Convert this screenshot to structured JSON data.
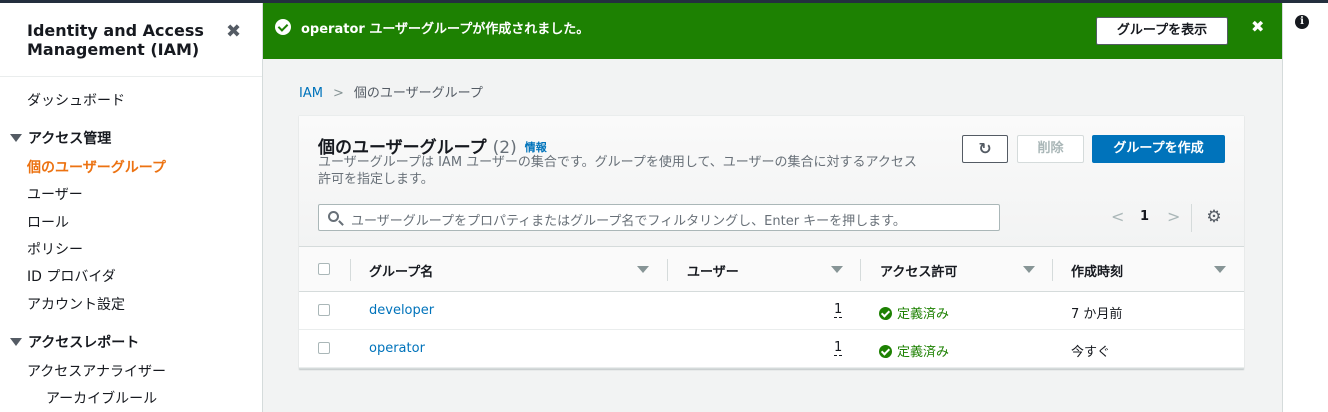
{
  "sidebar": {
    "title": "Identity and Access Management (IAM)",
    "dashboard": "ダッシュボード",
    "access_management": {
      "label": "アクセス管理",
      "items": [
        "個のユーザーグループ",
        "ユーザー",
        "ロール",
        "ポリシー",
        "ID プロバイダ",
        "アカウント設定"
      ]
    },
    "access_reports": {
      "label": "アクセスレポート",
      "items": [
        "アクセスアナライザー",
        "アーカイブルール"
      ]
    }
  },
  "flash": {
    "message": "operator ユーザーグループが作成されました。",
    "view_button": "グループを表示",
    "color": "#1d8102"
  },
  "breadcrumb": {
    "root": "IAM",
    "current": "個のユーザーグループ"
  },
  "panel": {
    "title": "個のユーザーグループ",
    "count": "(2)",
    "info_link": "情報",
    "description": "ユーザーグループは IAM ユーザーの集合です。グループを使用して、ユーザーの集合に対するアクセス許可を指定します。",
    "delete_button": "削除",
    "create_button": "グループを作成",
    "search_placeholder": "ユーザーグループをプロパティまたはグループ名でフィルタリングし、Enter キーを押します。",
    "page": "1"
  },
  "table": {
    "columns": [
      "グループ名",
      "ユーザー",
      "アクセス許可",
      "作成時刻"
    ],
    "rows": [
      {
        "name": "developer",
        "users": "1",
        "permissions": "定義済み",
        "created": "7 か月前"
      },
      {
        "name": "operator",
        "users": "1",
        "permissions": "定義済み",
        "created": "今すぐ"
      }
    ]
  },
  "colors": {
    "primary": "#0073bb",
    "active_nav": "#ec7211",
    "success": "#1d8102"
  },
  "icons": {
    "close": "close-icon",
    "refresh": "refresh-icon",
    "search": "search-icon",
    "settings": "gear-icon",
    "info": "info-icon"
  }
}
